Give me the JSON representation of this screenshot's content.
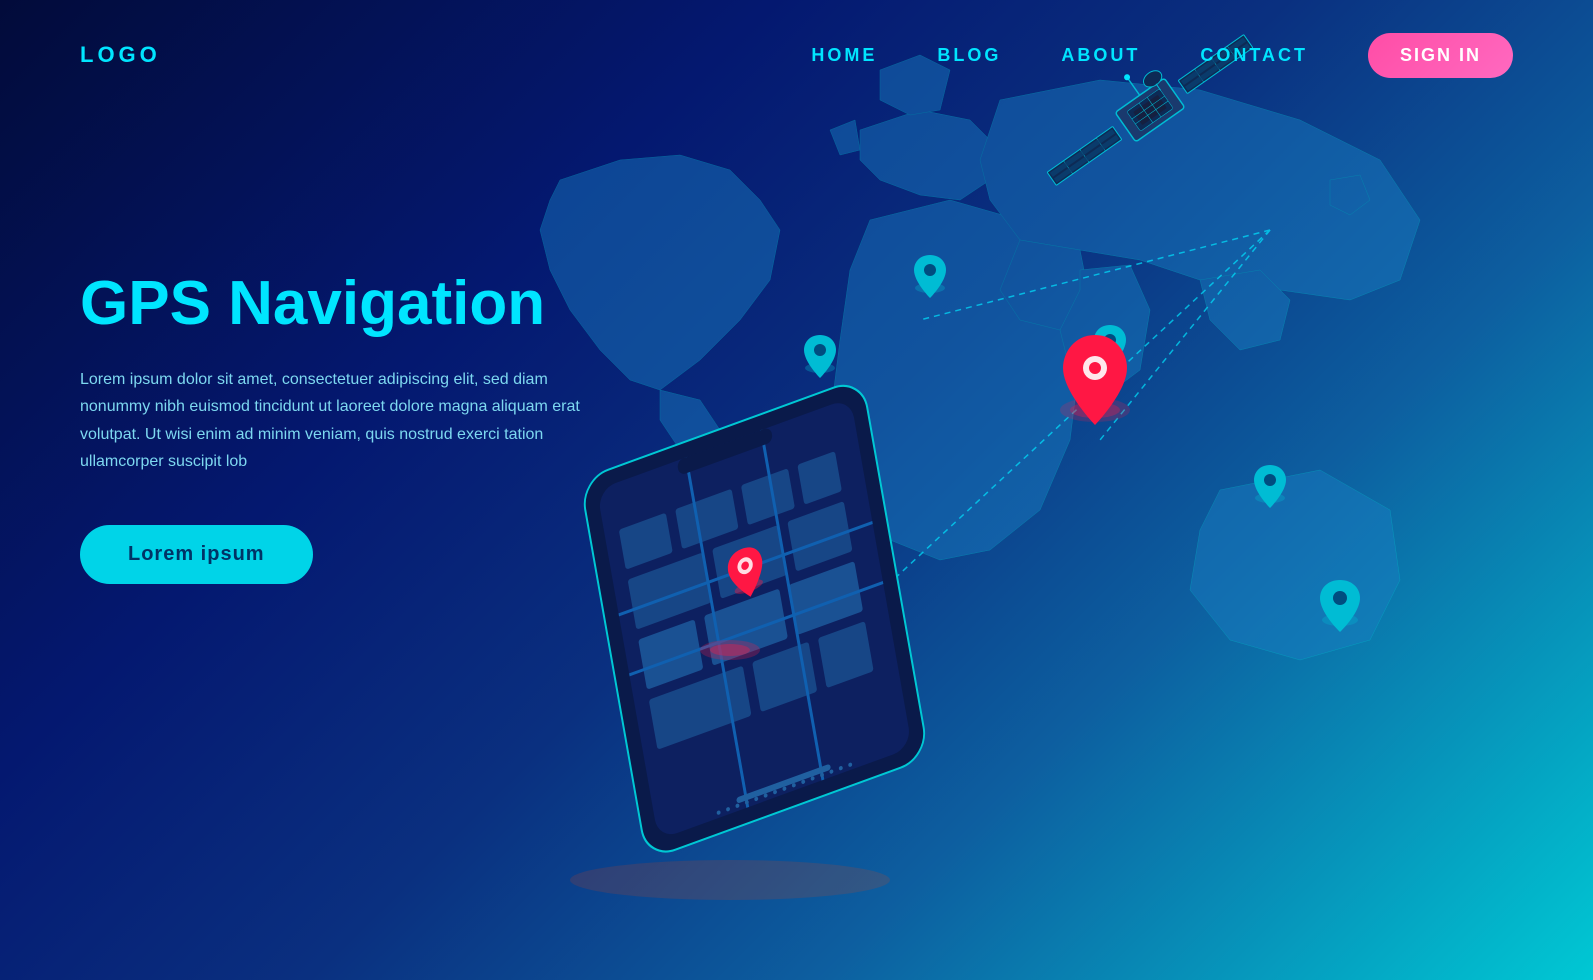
{
  "nav": {
    "logo": "LOGO",
    "links": [
      {
        "label": "HOME",
        "id": "home"
      },
      {
        "label": "BLOG",
        "id": "blog"
      },
      {
        "label": "ABOUT",
        "id": "about"
      },
      {
        "label": "CONTACT",
        "id": "contact"
      }
    ],
    "signin": "SIGN IN"
  },
  "hero": {
    "title": "GPS Navigation",
    "description": "Lorem ipsum dolor sit amet, consectetuer adipiscing elit, sed diam nonummy nibh euismod tincidunt ut laoreet dolore magna aliquam erat volutpat. Ut wisi enim ad minim veniam, quis nostrud exerci tation ullamcorper suscipit lob",
    "button": "Lorem ipsum"
  },
  "colors": {
    "background_start": "#020b3a",
    "background_end": "#00c8d4",
    "accent_cyan": "#00e5ff",
    "accent_pink": "#ff4da6",
    "pin_red": "#ff1744",
    "pin_cyan": "#00bcd4"
  }
}
